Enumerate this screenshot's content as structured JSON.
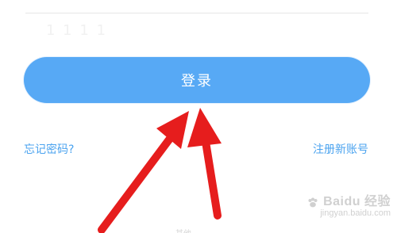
{
  "screen": {
    "login_button": "登录",
    "forgot_password": "忘记密码?",
    "register": "注册新账号",
    "faint_placeholder": "1 1 1 1",
    "bottom_hint": "其他"
  },
  "watermark": {
    "brand": "Baidu 经验",
    "url": "jingyan.baidu.com"
  },
  "colors": {
    "accent": "#57a9f5",
    "link": "#4ba3ef",
    "arrow": "#e61d1d"
  },
  "icons": {
    "arrows": "red-pointer-arrows-icon",
    "paw": "baidu-paw-icon"
  }
}
